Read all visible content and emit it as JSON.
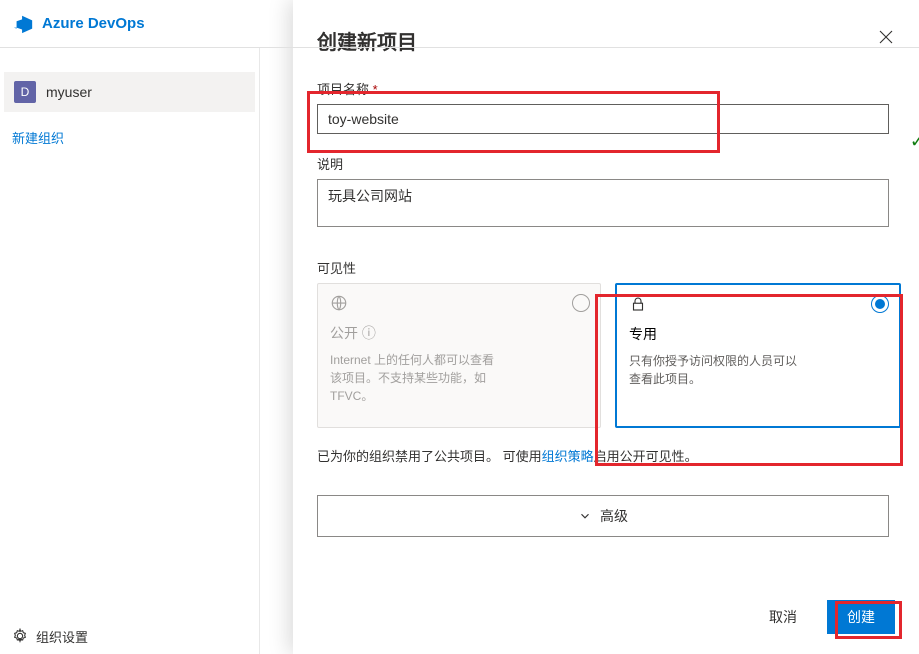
{
  "topbar": {
    "brand": "Azure DevOps"
  },
  "sidebar": {
    "avatar_letter": "D",
    "user_name": "myuser",
    "new_org": "新建组织",
    "org_settings": "组织设置"
  },
  "panel": {
    "title": "创建新项目",
    "name_label": "项目名称",
    "name_value": "toy-website",
    "desc_label": "说明",
    "desc_value": "玩具公司网站",
    "visibility_label": "可见性",
    "public": {
      "title": "公开",
      "info_icon": "ⓘ",
      "desc": "Internet 上的任何人都可以查看该项目。不支持某些功能，如 TFVC。"
    },
    "private": {
      "title": "专用",
      "desc": "只有你授予访问权限的人员可以查看此项目。"
    },
    "policy_pre": "已为你的组织禁用了公共项目。 可使用",
    "policy_link": "组织策略",
    "policy_post": "启用公开可见性。",
    "advanced": "高级",
    "cancel": "取消",
    "create": "创建"
  }
}
